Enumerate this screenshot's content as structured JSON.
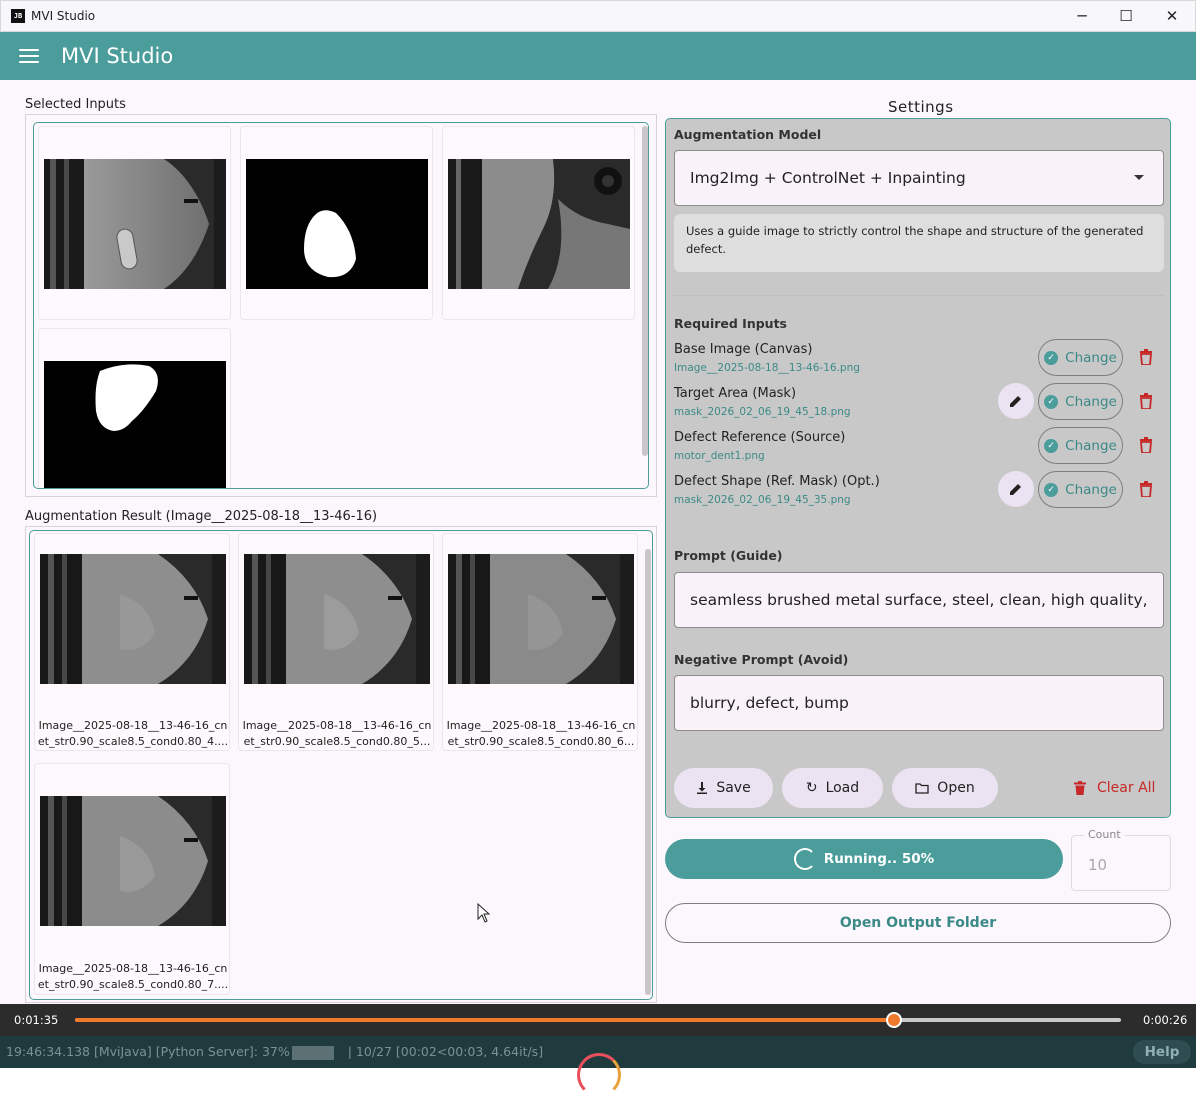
{
  "window": {
    "title": "MVI Studio",
    "minimize": "─",
    "maximize": "☐",
    "close": "✕"
  },
  "appbar": {
    "title": "MVI Studio"
  },
  "selected_inputs": {
    "label": "Selected Inputs"
  },
  "result": {
    "label": "Augmentation Result (Image__2025-08-18__13-46-16)",
    "items": [
      {
        "caption_1": "Image__2025-08-18__13-46-16_cn",
        "caption_2": "et_str0.90_scale8.5_cond0.80_4...."
      },
      {
        "caption_1": "Image__2025-08-18__13-46-16_cn",
        "caption_2": "et_str0.90_scale8.5_cond0.80_5..."
      },
      {
        "caption_1": "Image__2025-08-18__13-46-16_cn",
        "caption_2": "et_str0.90_scale8.5_cond0.80_6..."
      },
      {
        "caption_1": "Image__2025-08-18__13-46-16_cn",
        "caption_2": "et_str0.90_scale8.5_cond0.80_7...."
      }
    ]
  },
  "settings": {
    "title": "Settings",
    "model_label": "Augmentation Model",
    "model_value": "Img2Img + ControlNet + Inpainting",
    "model_desc": "Uses a guide image to strictly control the shape and structure of the generated defect.",
    "required_label": "Required Inputs",
    "inputs": [
      {
        "name": "Base Image (Canvas)",
        "file": "Image__2025-08-18__13-46-16.png"
      },
      {
        "name": "Target Area (Mask)",
        "file": "mask_2026_02_06_19_45_18.png"
      },
      {
        "name": "Defect Reference (Source)",
        "file": "motor_dent1.png"
      },
      {
        "name": "Defect Shape (Ref. Mask) (Opt.)",
        "file": "mask_2026_02_06_19_45_35.png"
      }
    ],
    "change_label": "Change",
    "prompt_label": "Prompt (Guide)",
    "prompt_value": "seamless brushed metal surface, steel, clean, high quality,",
    "neg_label": "Negative Prompt (Avoid)",
    "neg_value": "blurry, defect, bump",
    "save": "Save",
    "load": "Load",
    "open": "Open",
    "clear_all": "Clear All"
  },
  "run": {
    "label": "Running.. 50%",
    "progress": 0.5
  },
  "count": {
    "label": "Count",
    "value": "10"
  },
  "output_folder": "Open Output Folder",
  "media": {
    "elapsed": "0:01:35",
    "remaining": "0:00:26",
    "position": 0.783
  },
  "status": {
    "text_left": "19:46:34.138 [MviJava] [Python Server]: 37%",
    "text_right": "| 10/27 [00:02<00:03,  4.64it/s]",
    "help": "Help"
  },
  "colors": {
    "accent": "#4a9d9b",
    "media_progress": "#f07a2c",
    "danger": "#c62828"
  }
}
